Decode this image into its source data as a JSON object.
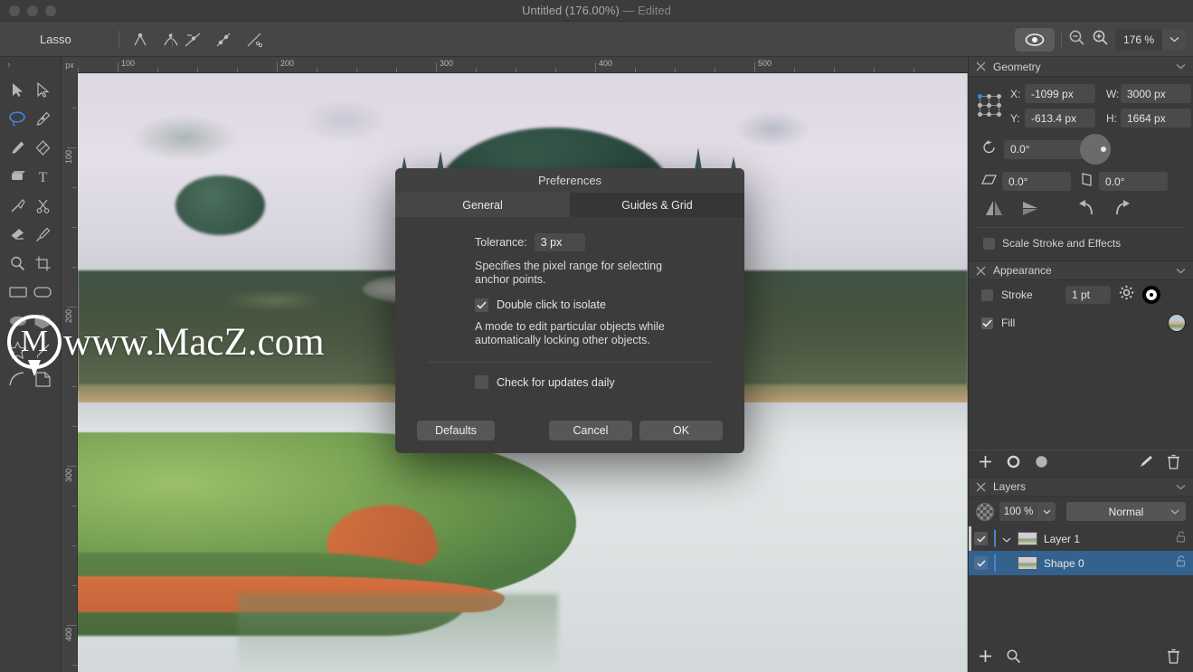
{
  "window": {
    "title": "Untitled (176.00%)",
    "edited_suffix": "— Edited"
  },
  "toolbar": {
    "tool_name": "Lasso",
    "node_icons": [
      "corner-node-icon",
      "smooth-node-icon"
    ],
    "path_icons": [
      "cut-path-icon",
      "join-path-icon",
      "split-path-icon"
    ],
    "eye_icon": "preview-eye-icon",
    "zoom_out_icon": "zoom-out-icon",
    "zoom_in_icon": "zoom-in-icon",
    "zoom_value": "176 %",
    "zoom_chevron": "chevron-down-icon"
  },
  "palette": {
    "handle_icon": "chevron-right-icon",
    "tools": [
      {
        "name": "move-tool",
        "icon": "cursor-arrow-filled-icon",
        "active": false
      },
      {
        "name": "node-tool",
        "icon": "cursor-arrow-outline-icon",
        "active": false
      },
      {
        "name": "lasso-tool",
        "icon": "lasso-icon",
        "active": true
      },
      {
        "name": "pen-tool",
        "icon": "pen-nib-icon",
        "active": false
      },
      {
        "name": "pencil-tool",
        "icon": "pencil-icon",
        "active": false
      },
      {
        "name": "shape-builder-tool",
        "icon": "node-shape-icon",
        "active": false
      },
      {
        "name": "fill-tool",
        "icon": "fill-bucket-icon",
        "active": false
      },
      {
        "name": "text-tool",
        "icon": "text-t-icon",
        "active": false
      },
      {
        "name": "knife-tool",
        "icon": "knife-icon",
        "active": false
      },
      {
        "name": "scissors-tool",
        "icon": "scissors-icon",
        "active": false
      },
      {
        "name": "eraser-tool",
        "icon": "eraser-icon",
        "active": false
      },
      {
        "name": "eyedropper-tool",
        "icon": "eyedropper-icon",
        "active": false
      },
      {
        "name": "zoom-tool",
        "icon": "magnifier-icon",
        "active": false
      },
      {
        "name": "crop-tool",
        "icon": "crop-frame-icon",
        "active": false
      },
      {
        "name": "rectangle-tool",
        "icon": "rectangle-icon",
        "active": false
      },
      {
        "name": "rounded-rectangle-tool",
        "icon": "rounded-rectangle-icon",
        "active": false
      },
      {
        "name": "ellipse-tool",
        "icon": "ellipse-icon",
        "active": false
      },
      {
        "name": "polygon-tool",
        "icon": "polygon-icon",
        "active": false
      },
      {
        "name": "star-tool",
        "icon": "star-icon",
        "active": false
      },
      {
        "name": "spiral-tool",
        "icon": "spiral-icon",
        "active": false
      },
      {
        "name": "arc-tool",
        "icon": "arc-icon",
        "active": false
      },
      {
        "name": "page-shape-tool",
        "icon": "page-corner-icon",
        "active": false
      }
    ]
  },
  "rulers": {
    "unit": "px",
    "horizontal_labels": [
      "100",
      "200",
      "300",
      "400",
      "500"
    ],
    "vertical_labels": [
      "100",
      "200",
      "300",
      "400"
    ]
  },
  "watermark": {
    "logo_letter": "M",
    "text": "www.MacZ.com"
  },
  "geometry": {
    "panel_title": "Geometry",
    "close_icon": "close-x-icon",
    "collapse_icon": "chevron-down-icon",
    "anchor_icon": "anchor-grid-icon",
    "x_label": "X:",
    "x_value": "-1099 px",
    "y_label": "Y:",
    "y_value": "-613.4 px",
    "w_label": "W:",
    "w_value": "3000 px",
    "h_label": "H:",
    "h_value": "1664 px",
    "link_icon": "link-ratio-icon",
    "rotation_icon": "rotate-ccw-icon",
    "rotation_value": "0.0°",
    "shear_x_icon": "shear-horizontal-icon",
    "shear_x_value": "0.0°",
    "shear_y_icon": "shear-vertical-icon",
    "shear_y_value": "0.0°",
    "flip_horizontal_icon": "flip-horizontal-icon",
    "flip_vertical_icon": "flip-vertical-icon",
    "rotate_left_icon": "rotate-left-icon",
    "rotate_right_icon": "rotate-right-icon",
    "scale_stroke_label": "Scale Stroke and Effects",
    "scale_stroke_checked": false
  },
  "appearance": {
    "panel_title": "Appearance",
    "close_icon": "close-x-icon",
    "collapse_icon": "chevron-down-icon",
    "stroke_label": "Stroke",
    "stroke_checked": false,
    "stroke_width": "1 pt",
    "stroke_settings_icon": "gear-icon",
    "stroke_swatch": "black-ring-swatch",
    "fill_label": "Fill",
    "fill_checked": true,
    "fill_swatch": "image-fill-swatch",
    "toolbar_icons": [
      "add-icon",
      "ring-icon",
      "filled-circle-icon",
      "brush-icon",
      "trash-icon"
    ]
  },
  "layers": {
    "panel_title": "Layers",
    "close_icon": "close-x-icon",
    "collapse_icon": "chevron-down-icon",
    "opacity_icon": "checker-circle-icon",
    "opacity_value": "100 %",
    "opacity_chevron": "chevron-down-icon",
    "blend_mode": "Normal",
    "blend_chevron": "chevron-down-icon",
    "rows": [
      {
        "name": "Layer 1",
        "checked": true,
        "selected": false,
        "expand_icon": "chevron-down-icon",
        "lock_icon": "lock-open-icon",
        "thumb": "layer-thumbnail"
      },
      {
        "name": "Shape 0",
        "checked": true,
        "selected": true,
        "expand_icon": "",
        "lock_icon": "lock-open-icon",
        "thumb": "layer-thumbnail"
      }
    ],
    "footer_icons": [
      "add-layer-icon",
      "search-icon",
      "trash-icon"
    ]
  },
  "dialog": {
    "title": "Preferences",
    "tabs": [
      {
        "label": "General",
        "active": true
      },
      {
        "label": "Guides & Grid",
        "active": false
      }
    ],
    "tolerance_label": "Tolerance:",
    "tolerance_value": "3 px",
    "tolerance_desc": "Specifies the pixel range for selecting anchor points.",
    "isolate_label": "Double click to isolate",
    "isolate_checked": true,
    "isolate_desc": "A mode to edit particular objects while automatically locking other objects.",
    "updates_label": "Check for updates daily",
    "updates_checked": false,
    "defaults_button": "Defaults",
    "cancel_button": "Cancel",
    "ok_button": "OK"
  },
  "colors": {
    "accent_blue": "#3b87e0",
    "selection_blue": "#33628f",
    "panel_bg": "#3a3a3a",
    "dialog_bg": "#3c3c3c"
  }
}
